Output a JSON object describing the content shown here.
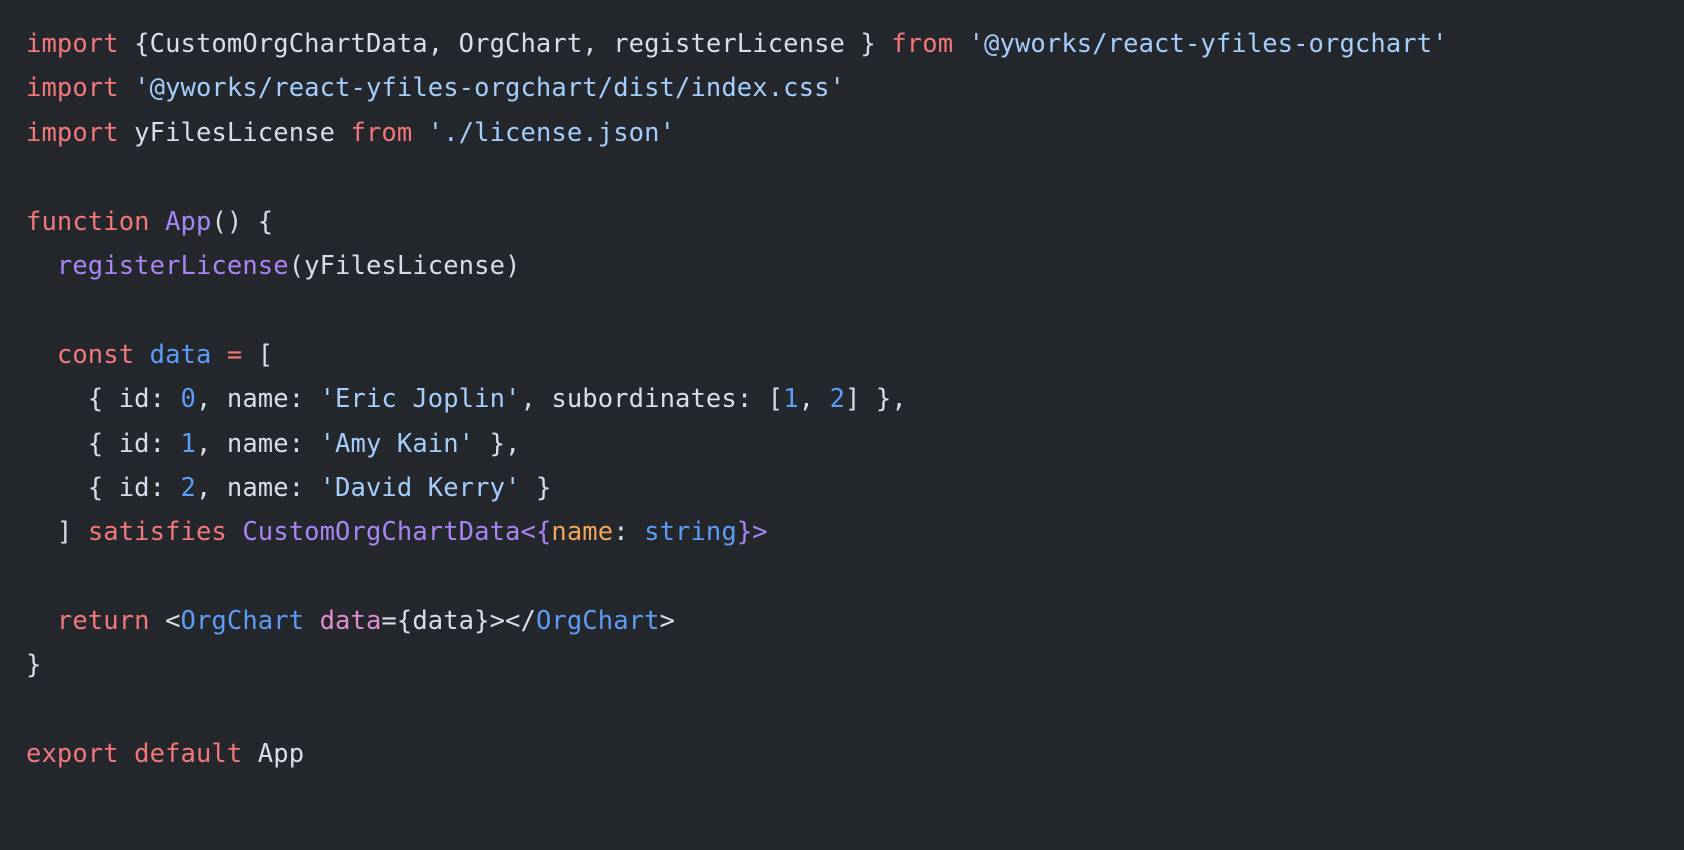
{
  "editor": {
    "background_color": "#24282d",
    "language": "tsx",
    "theme_colors": {
      "keyword": "#f2777a",
      "string": "#a5cdfb",
      "number": "#5c9cf5",
      "identifier": "#a785f2",
      "variable": "#5c9cf5",
      "jsx_tag": "#5c9cf5",
      "jsx_attribute": "#e28cd0",
      "property": "#f0a45d",
      "plain": "#d8dee9"
    }
  },
  "code": {
    "lines": [
      {
        "index": 1,
        "text": "import {CustomOrgChartData, OrgChart, registerLicense } from '@yworks/react-yfiles-orgchart'",
        "tokens": [
          {
            "text": "import",
            "type": "kw"
          },
          {
            "text": " {CustomOrgChartData, OrgChart, registerLicense } ",
            "type": "plain"
          },
          {
            "text": "from",
            "type": "kw"
          },
          {
            "text": " ",
            "type": "plain"
          },
          {
            "text": "'@yworks/react-yfiles-orgchart'",
            "type": "str"
          }
        ]
      },
      {
        "index": 2,
        "text": "import '@yworks/react-yfiles-orgchart/dist/index.css'",
        "tokens": [
          {
            "text": "import",
            "type": "kw"
          },
          {
            "text": " ",
            "type": "plain"
          },
          {
            "text": "'@yworks/react-yfiles-orgchart/dist/index.css'",
            "type": "str"
          }
        ]
      },
      {
        "index": 3,
        "text": "import yFilesLicense from './license.json'",
        "tokens": [
          {
            "text": "import",
            "type": "kw"
          },
          {
            "text": " yFilesLicense ",
            "type": "plain"
          },
          {
            "text": "from",
            "type": "kw"
          },
          {
            "text": " ",
            "type": "plain"
          },
          {
            "text": "'./license.json'",
            "type": "str"
          }
        ]
      },
      {
        "index": 4,
        "text": "",
        "tokens": []
      },
      {
        "index": 5,
        "text": "function App() {",
        "tokens": [
          {
            "text": "function",
            "type": "kw"
          },
          {
            "text": " ",
            "type": "plain"
          },
          {
            "text": "App",
            "type": "ident"
          },
          {
            "text": "() {",
            "type": "plain"
          }
        ]
      },
      {
        "index": 6,
        "text": "  registerLicense(yFilesLicense)",
        "tokens": [
          {
            "text": "  ",
            "type": "plain"
          },
          {
            "text": "registerLicense",
            "type": "ident"
          },
          {
            "text": "(yFilesLicense)",
            "type": "plain"
          }
        ]
      },
      {
        "index": 7,
        "text": "",
        "tokens": []
      },
      {
        "index": 8,
        "text": "  const data = [",
        "tokens": [
          {
            "text": "  ",
            "type": "plain"
          },
          {
            "text": "const",
            "type": "kw"
          },
          {
            "text": " ",
            "type": "plain"
          },
          {
            "text": "data",
            "type": "var"
          },
          {
            "text": " ",
            "type": "plain"
          },
          {
            "text": "=",
            "type": "kw"
          },
          {
            "text": " [",
            "type": "plain"
          }
        ]
      },
      {
        "index": 9,
        "text": "    { id: 0, name: 'Eric Joplin', subordinates: [1, 2] },",
        "tokens": [
          {
            "text": "    { id: ",
            "type": "plain"
          },
          {
            "text": "0",
            "type": "num"
          },
          {
            "text": ", name: ",
            "type": "plain"
          },
          {
            "text": "'Eric Joplin'",
            "type": "str"
          },
          {
            "text": ", subordinates: [",
            "type": "plain"
          },
          {
            "text": "1",
            "type": "num"
          },
          {
            "text": ", ",
            "type": "plain"
          },
          {
            "text": "2",
            "type": "num"
          },
          {
            "text": "] },",
            "type": "plain"
          }
        ]
      },
      {
        "index": 10,
        "text": "    { id: 1, name: 'Amy Kain' },",
        "tokens": [
          {
            "text": "    { id: ",
            "type": "plain"
          },
          {
            "text": "1",
            "type": "num"
          },
          {
            "text": ", name: ",
            "type": "plain"
          },
          {
            "text": "'Amy Kain'",
            "type": "str"
          },
          {
            "text": " },",
            "type": "plain"
          }
        ]
      },
      {
        "index": 11,
        "text": "    { id: 2, name: 'David Kerry' }",
        "tokens": [
          {
            "text": "    { id: ",
            "type": "plain"
          },
          {
            "text": "2",
            "type": "num"
          },
          {
            "text": ", name: ",
            "type": "plain"
          },
          {
            "text": "'David Kerry'",
            "type": "str"
          },
          {
            "text": " }",
            "type": "plain"
          }
        ]
      },
      {
        "index": 12,
        "text": "  ] satisfies CustomOrgChartData<{name: string}>",
        "tokens": [
          {
            "text": "  ] ",
            "type": "plain"
          },
          {
            "text": "satisfies",
            "type": "kw"
          },
          {
            "text": " ",
            "type": "plain"
          },
          {
            "text": "CustomOrgChartData",
            "type": "ident"
          },
          {
            "text": "<{",
            "type": "ident"
          },
          {
            "text": "name",
            "type": "prop"
          },
          {
            "text": ": ",
            "type": "plain"
          },
          {
            "text": "string",
            "type": "type"
          },
          {
            "text": "}",
            "type": "ident"
          },
          {
            "text": ">",
            "type": "ident"
          }
        ]
      },
      {
        "index": 13,
        "text": "",
        "tokens": []
      },
      {
        "index": 14,
        "text": "  return <OrgChart data={data}></OrgChart>",
        "tokens": [
          {
            "text": "  ",
            "type": "plain"
          },
          {
            "text": "return",
            "type": "kw"
          },
          {
            "text": " <",
            "type": "plain"
          },
          {
            "text": "OrgChart",
            "type": "tag"
          },
          {
            "text": " ",
            "type": "plain"
          },
          {
            "text": "data",
            "type": "attr"
          },
          {
            "text": "={data}></",
            "type": "plain"
          },
          {
            "text": "OrgChart",
            "type": "tag"
          },
          {
            "text": ">",
            "type": "plain"
          }
        ]
      },
      {
        "index": 15,
        "text": "}",
        "tokens": [
          {
            "text": "}",
            "type": "plain"
          }
        ]
      },
      {
        "index": 16,
        "text": "",
        "tokens": []
      },
      {
        "index": 17,
        "text": "export default App",
        "tokens": [
          {
            "text": "export",
            "type": "kw"
          },
          {
            "text": " ",
            "type": "plain"
          },
          {
            "text": "default",
            "type": "kw"
          },
          {
            "text": " App",
            "type": "plain"
          }
        ]
      }
    ]
  }
}
